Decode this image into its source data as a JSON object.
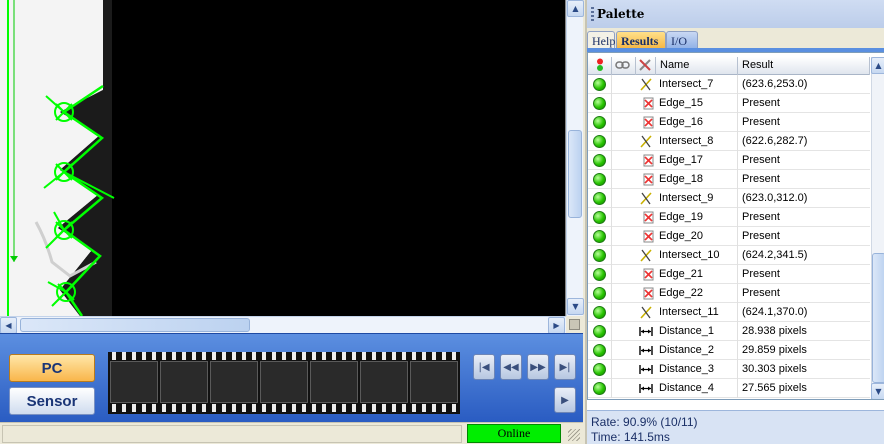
{
  "palette": {
    "title": "Palette",
    "tabs": [
      {
        "label": "Help",
        "active": false
      },
      {
        "label": "Results",
        "active": true
      },
      {
        "label": "I/O",
        "active": false
      }
    ],
    "columns": {
      "name": "Name",
      "result": "Result"
    },
    "rows": [
      {
        "name": "Intersect_7",
        "result": "(623.6,253.0)",
        "tool": "intersect-icon",
        "indent": 1,
        "status": "pass"
      },
      {
        "name": "Edge_15",
        "result": "Present",
        "tool": "edge-icon",
        "indent": 1,
        "status": "pass"
      },
      {
        "name": "Edge_16",
        "result": "Present",
        "tool": "edge-icon",
        "indent": 1,
        "status": "pass"
      },
      {
        "name": "Intersect_8",
        "result": "(622.6,282.7)",
        "tool": "intersect-icon",
        "indent": 1,
        "status": "pass"
      },
      {
        "name": "Edge_17",
        "result": "Present",
        "tool": "edge-icon",
        "indent": 1,
        "status": "pass"
      },
      {
        "name": "Edge_18",
        "result": "Present",
        "tool": "edge-icon",
        "indent": 1,
        "status": "pass"
      },
      {
        "name": "Intersect_9",
        "result": "(623.0,312.0)",
        "tool": "intersect-icon",
        "indent": 1,
        "status": "pass"
      },
      {
        "name": "Edge_19",
        "result": "Present",
        "tool": "edge-icon",
        "indent": 1,
        "status": "pass"
      },
      {
        "name": "Edge_20",
        "result": "Present",
        "tool": "edge-icon",
        "indent": 1,
        "status": "pass"
      },
      {
        "name": "Intersect_10",
        "result": "(624.2,341.5)",
        "tool": "intersect-icon",
        "indent": 1,
        "status": "pass"
      },
      {
        "name": "Edge_21",
        "result": "Present",
        "tool": "edge-icon",
        "indent": 1,
        "status": "pass"
      },
      {
        "name": "Edge_22",
        "result": "Present",
        "tool": "edge-icon",
        "indent": 1,
        "status": "pass"
      },
      {
        "name": "Intersect_11",
        "result": "(624.1,370.0)",
        "tool": "intersect-icon",
        "indent": 0,
        "status": "pass"
      },
      {
        "name": "Distance_1",
        "result": "28.938 pixels",
        "tool": "distance-icon",
        "indent": 0,
        "status": "pass"
      },
      {
        "name": "Distance_2",
        "result": "29.859 pixels",
        "tool": "distance-icon",
        "indent": 0,
        "status": "pass"
      },
      {
        "name": "Distance_3",
        "result": "30.303 pixels",
        "tool": "distance-icon",
        "indent": 0,
        "status": "pass"
      },
      {
        "name": "Distance_4",
        "result": "27.565 pixels",
        "tool": "distance-icon",
        "indent": 0,
        "status": "pass"
      }
    ],
    "footer": {
      "rate": "Rate: 90.9% (10/11)",
      "time": "Time: 141.5ms"
    }
  },
  "controls": {
    "pc_label": "PC",
    "sensor_label": "Sensor"
  },
  "status": {
    "online_label": "Online"
  },
  "colors": {
    "pass": "#27c400",
    "overlay": "#00ff00",
    "accent": "#f5b543",
    "online": "#00ee00"
  }
}
